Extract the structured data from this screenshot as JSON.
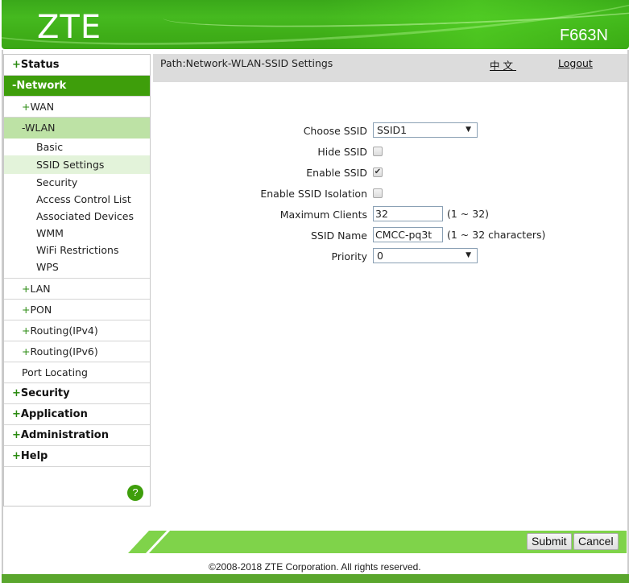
{
  "header": {
    "logo": "ZTE",
    "model": "F663N"
  },
  "sidebar": {
    "items": [
      {
        "sign": "+",
        "label": "Status"
      },
      {
        "sign": "-",
        "label": "Network",
        "active": true
      },
      {
        "sign": "+",
        "label": "Security"
      },
      {
        "sign": "+",
        "label": "Application"
      },
      {
        "sign": "+",
        "label": "Administration"
      },
      {
        "sign": "+",
        "label": "Help"
      }
    ],
    "network_children": [
      {
        "sign": "+",
        "label": "WAN"
      },
      {
        "sign": "-",
        "label": "WLAN"
      },
      {
        "sign": "+",
        "label": "LAN"
      },
      {
        "sign": "+",
        "label": "PON"
      },
      {
        "sign": "+",
        "label": "Routing(IPv4)"
      },
      {
        "sign": "+",
        "label": "Routing(IPv6)"
      },
      {
        "sign": "",
        "label": "Port Locating"
      }
    ],
    "wlan_children": [
      "Basic",
      "SSID Settings",
      "Security",
      "Access Control List",
      "Associated Devices",
      "WMM",
      "WiFi Restrictions",
      "WPS"
    ],
    "selected": "SSID Settings",
    "help_icon": "?"
  },
  "pathbar": {
    "path": "Path:Network-WLAN-SSID Settings",
    "language_link": "中文",
    "logout_link": "Logout"
  },
  "form": {
    "choose_ssid": {
      "label": "Choose SSID",
      "value": "SSID1"
    },
    "hide_ssid": {
      "label": "Hide SSID",
      "checked": false
    },
    "enable_ssid": {
      "label": "Enable SSID",
      "checked": true
    },
    "enable_isolation": {
      "label": "Enable SSID Isolation",
      "checked": false
    },
    "max_clients": {
      "label": "Maximum Clients",
      "value": "32",
      "hint": "(1 ~ 32)"
    },
    "ssid_name": {
      "label": "SSID Name",
      "value": "CMCC-pq3t",
      "hint": "(1 ~ 32 characters)"
    },
    "priority": {
      "label": "Priority",
      "value": "0"
    },
    "dropdown_arrow": "▼",
    "check_mark": "✔"
  },
  "footer": {
    "submit_label": "Submit",
    "cancel_label": "Cancel",
    "copyright": "©2008-2018 ZTE Corporation. All rights reserved."
  },
  "colors": {
    "brand_green": "#3e9e0b",
    "footer_green": "#7fd34a",
    "path_gray": "#dcdcdc"
  }
}
